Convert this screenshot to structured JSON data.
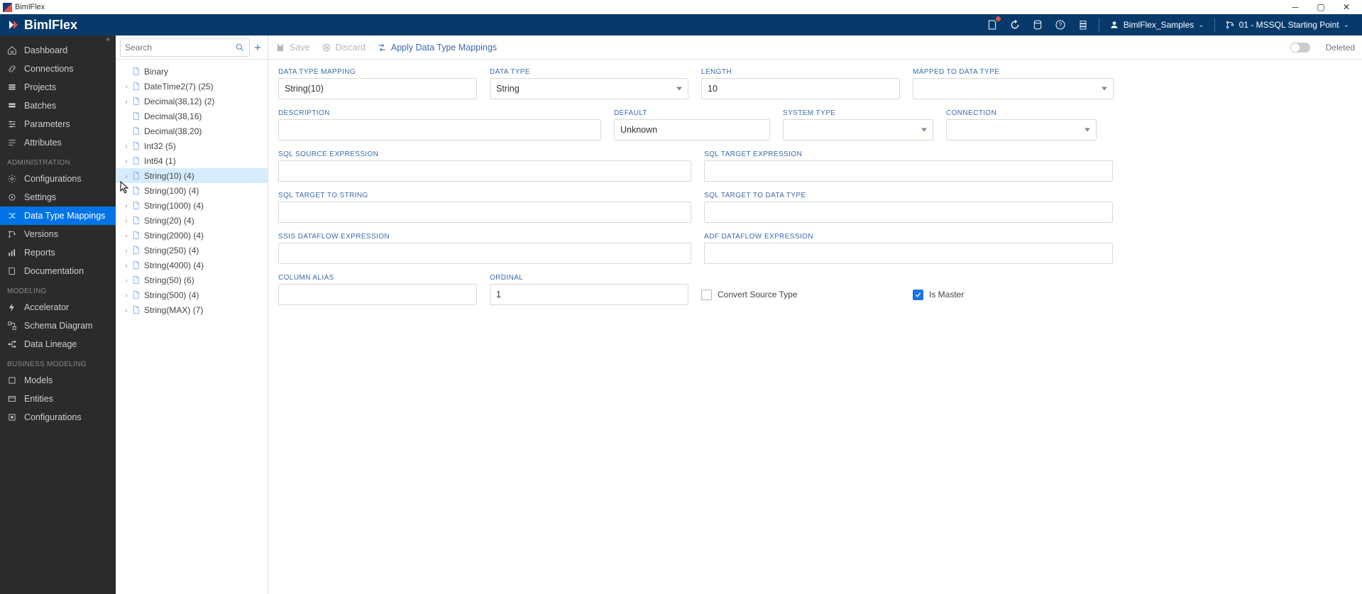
{
  "window": {
    "title": "BimlFlex"
  },
  "brand": {
    "text": "BimlFlex"
  },
  "topbar": {
    "customer": "BimlFlex_Samples",
    "version": "01 - MSSQL Starting Point"
  },
  "sidebar": {
    "top": [
      {
        "id": "dashboard",
        "label": "Dashboard",
        "icon": "home-icon"
      },
      {
        "id": "connections",
        "label": "Connections",
        "icon": "link-icon"
      },
      {
        "id": "projects",
        "label": "Projects",
        "icon": "layers-icon"
      },
      {
        "id": "batches",
        "label": "Batches",
        "icon": "stack-icon"
      },
      {
        "id": "parameters",
        "label": "Parameters",
        "icon": "sliders-icon"
      },
      {
        "id": "attributes",
        "label": "Attributes",
        "icon": "tags-icon"
      }
    ],
    "sections": {
      "administration": {
        "label": "ADMINISTRATION",
        "items": [
          {
            "id": "configurations",
            "label": "Configurations",
            "icon": "cog-icon"
          },
          {
            "id": "settings",
            "label": "Settings",
            "icon": "gear-icon"
          },
          {
            "id": "data-type-mappings",
            "label": "Data Type Mappings",
            "icon": "shuffle-icon",
            "active": true
          },
          {
            "id": "versions",
            "label": "Versions",
            "icon": "branch-icon"
          },
          {
            "id": "reports",
            "label": "Reports",
            "icon": "chart-icon"
          },
          {
            "id": "documentation",
            "label": "Documentation",
            "icon": "book-icon"
          }
        ]
      },
      "modeling": {
        "label": "MODELING",
        "items": [
          {
            "id": "accelerator",
            "label": "Accelerator",
            "icon": "bolt-icon"
          },
          {
            "id": "schema-diagram",
            "label": "Schema Diagram",
            "icon": "diagram-icon"
          },
          {
            "id": "data-lineage",
            "label": "Data Lineage",
            "icon": "lineage-icon"
          }
        ]
      },
      "business": {
        "label": "BUSINESS MODELING",
        "items": [
          {
            "id": "models",
            "label": "Models",
            "icon": "box-icon"
          },
          {
            "id": "entities",
            "label": "Entities",
            "icon": "entity-icon"
          },
          {
            "id": "bconfigurations",
            "label": "Configurations",
            "icon": "cog2-icon"
          }
        ]
      }
    }
  },
  "tree": {
    "search_placeholder": "Search",
    "items": [
      {
        "label": "Binary",
        "caret": "",
        "selected": false
      },
      {
        "label": "DateTime2(7) (25)",
        "caret": "›",
        "selected": false
      },
      {
        "label": "Decimal(38,12) (2)",
        "caret": "›",
        "selected": false
      },
      {
        "label": "Decimal(38,16)",
        "caret": "",
        "selected": false
      },
      {
        "label": "Decimal(38,20)",
        "caret": "",
        "selected": false
      },
      {
        "label": "Int32 (5)",
        "caret": "›",
        "selected": false
      },
      {
        "label": "Int64 (1)",
        "caret": "›",
        "selected": false
      },
      {
        "label": "String(10) (4)",
        "caret": "›",
        "selected": true
      },
      {
        "label": "String(100) (4)",
        "caret": "›",
        "selected": false
      },
      {
        "label": "String(1000) (4)",
        "caret": "›",
        "selected": false
      },
      {
        "label": "String(20) (4)",
        "caret": "›",
        "selected": false
      },
      {
        "label": "String(2000) (4)",
        "caret": "›",
        "selected": false
      },
      {
        "label": "String(250) (4)",
        "caret": "›",
        "selected": false
      },
      {
        "label": "String(4000) (4)",
        "caret": "›",
        "selected": false
      },
      {
        "label": "String(50) (6)",
        "caret": "›",
        "selected": false
      },
      {
        "label": "String(500) (4)",
        "caret": "›",
        "selected": false
      },
      {
        "label": "String(MAX) (7)",
        "caret": "›",
        "selected": false
      }
    ]
  },
  "actions": {
    "save": "Save",
    "discard": "Discard",
    "apply": "Apply Data Type Mappings",
    "deleted": "Deleted"
  },
  "form": {
    "labels": {
      "data_type_mapping": "DATA TYPE MAPPING",
      "data_type": "DATA TYPE",
      "length": "LENGTH",
      "mapped_to_data_type": "MAPPED TO DATA TYPE",
      "description": "DESCRIPTION",
      "default": "DEFAULT",
      "system_type": "SYSTEM TYPE",
      "connection": "CONNECTION",
      "sql_source_expression": "SQL SOURCE EXPRESSION",
      "sql_target_expression": "SQL TARGET EXPRESSION",
      "sql_target_to_string": "SQL TARGET TO STRING",
      "sql_target_to_data_type": "SQL TARGET TO DATA TYPE",
      "ssis_dataflow_expression": "SSIS DATAFLOW EXPRESSION",
      "adf_dataflow_expression": "ADF DATAFLOW EXPRESSION",
      "column_alias": "COLUMN ALIAS",
      "ordinal": "ORDINAL",
      "convert_source_type": "Convert Source Type",
      "is_master": "Is Master"
    },
    "values": {
      "data_type_mapping": "String(10)",
      "data_type": "String",
      "length": "10",
      "mapped_to_data_type": "",
      "description": "",
      "default": "Unknown",
      "system_type": "",
      "connection": "",
      "sql_source_expression": "",
      "sql_target_expression": "",
      "sql_target_to_string": "",
      "sql_target_to_data_type": "",
      "ssis_dataflow_expression": "",
      "adf_dataflow_expression": "",
      "column_alias": "",
      "ordinal": "1",
      "convert_source_type": false,
      "is_master": true
    }
  }
}
